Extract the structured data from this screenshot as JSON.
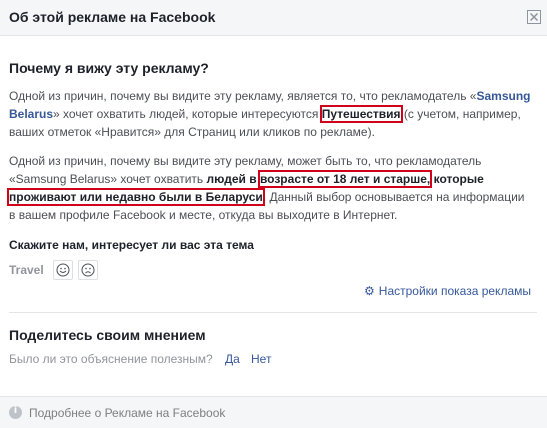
{
  "dialog": {
    "title": "Об этой рекламе на Facebook",
    "close_icon": "close-icon"
  },
  "why": {
    "heading": "Почему я вижу эту рекламу?",
    "p1": {
      "t1": "Одной из причин, почему вы видите эту рекламу, является то, что рекламодатель «",
      "advertiser": "Samsung Belarus",
      "t2": "» хочет охватить людей, которые интересуются ",
      "interest": "Путешествия",
      "t3": " (с учетом, например, ваших отметок «Нравится» для Страниц или кликов по рекламе)."
    },
    "p2": {
      "t1": "Одной из причин, почему вы видите эту рекламу, может быть то, что рекламодатель «Samsung Belarus» хочет охватить ",
      "b1": "людей в ",
      "age": "возрасте от 18 лет и старше,",
      "b2": " которые ",
      "location": "проживают или недавно были в Беларуси",
      "t2": ". Данный выбор основывается на информации в вашем профиле Facebook и месте, откуда вы выходите в Интернет."
    }
  },
  "topic": {
    "prompt": "Скажите нам, интересует ли вас эта тема",
    "label": "Travel",
    "like_icon": "smile-face-icon",
    "dislike_icon": "sad-face-icon"
  },
  "settings_link": "Настройки показа рекламы",
  "feedback": {
    "heading": "Поделитесь своим мнением",
    "question": "Было ли это объяснение полезным?",
    "yes": "Да",
    "no": "Нет"
  },
  "footer": {
    "text": "Подробнее о Рекламе на Facebook",
    "icon": "info-icon"
  },
  "colors": {
    "highlight": "#d0021b",
    "link": "#365899"
  }
}
